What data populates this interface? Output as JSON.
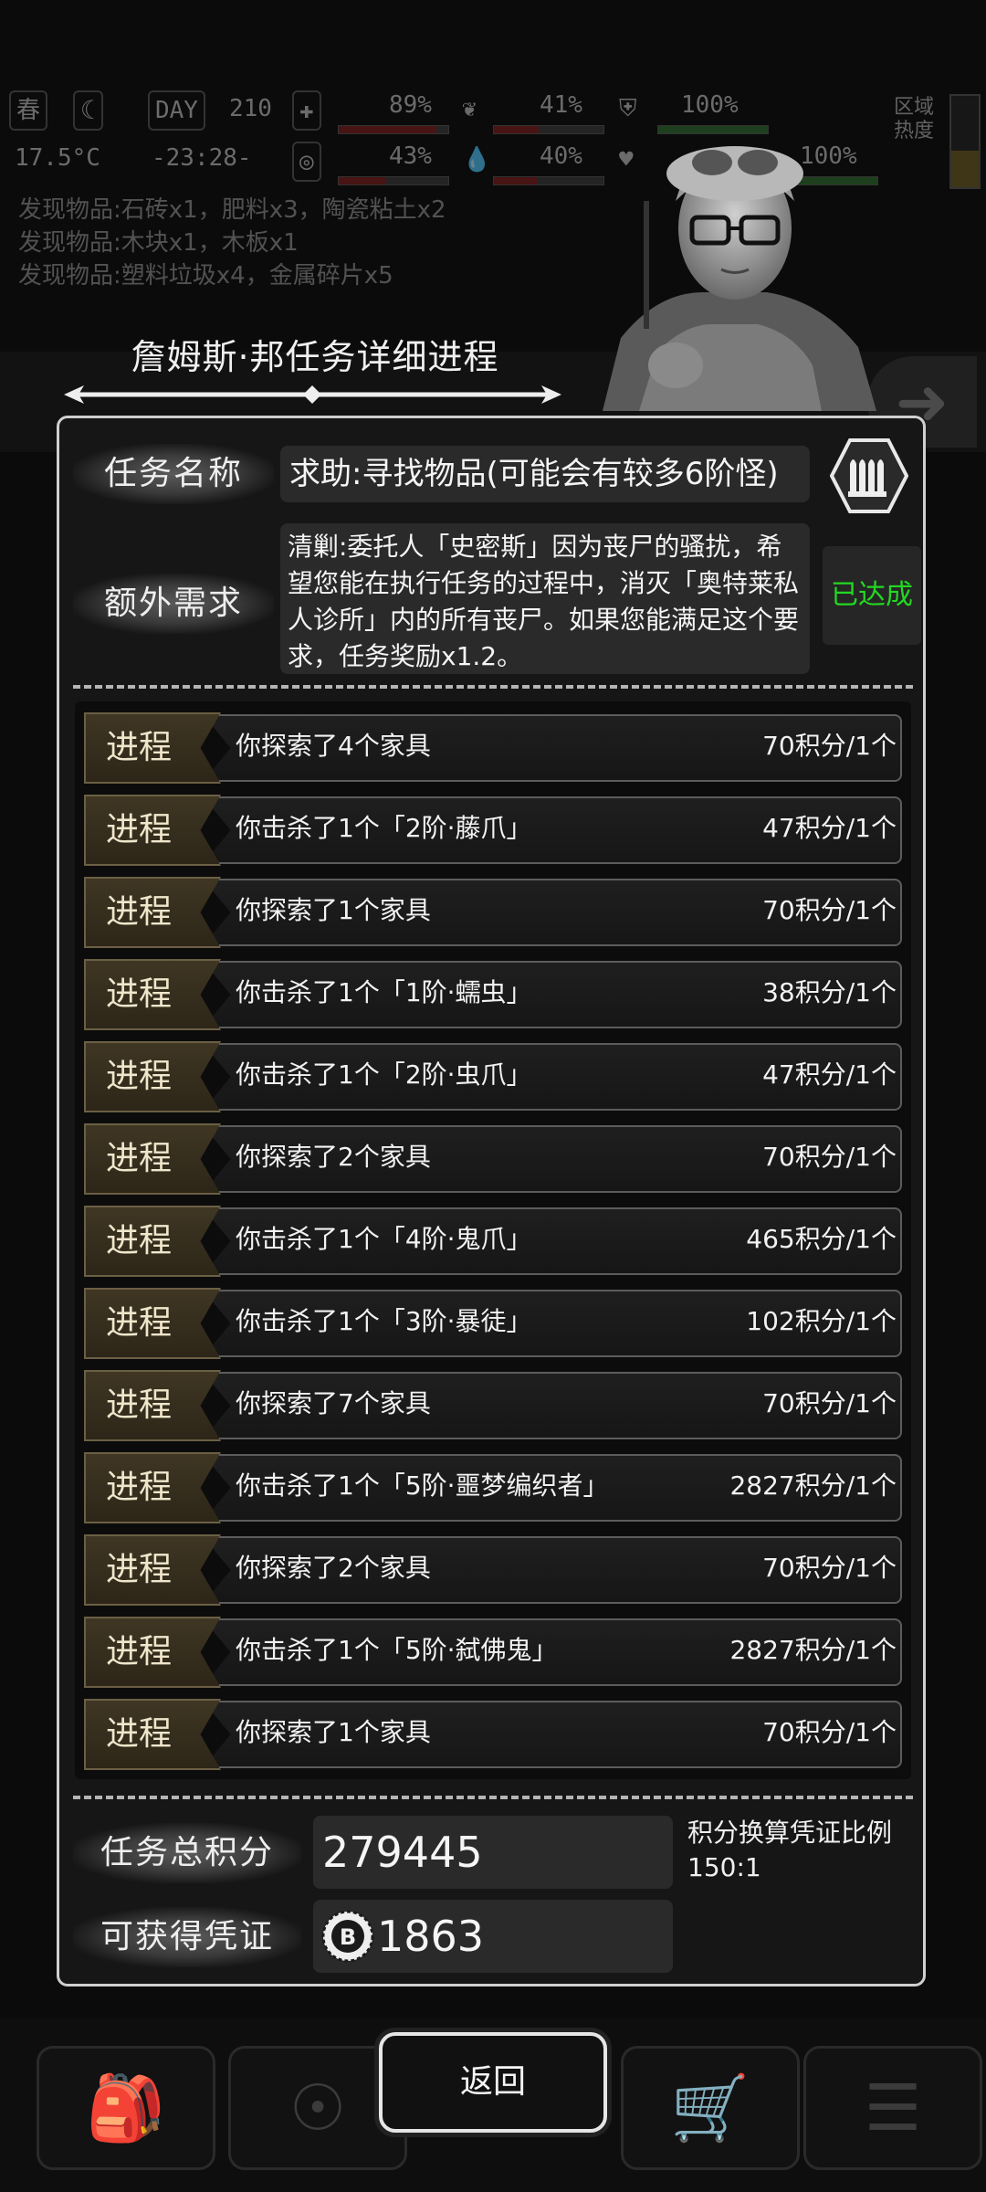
{
  "background": {
    "hud": {
      "season": "春",
      "temperature": "17.5°C",
      "day_label": "DAY",
      "day": "210",
      "time": "-23:28-",
      "health_pct": "89%",
      "sanity_pct": "43%",
      "stamina_pct": "41%",
      "water_pct": "40%",
      "armor_pct": "100%",
      "mood_pct": "100%",
      "zone_heat_label": "区域热度",
      "health_level": 0.89,
      "sanity_level": 0.43,
      "stamina_level": 0.41,
      "water_level": 0.4,
      "armor_level": 1.0,
      "mood_level": 1.0
    },
    "log_lines": [
      "发现物品:石砖x1，肥料x3，陶瓷粘土x2",
      "发现物品:木块x1，木板x1",
      "发现物品:塑料垃圾x4，金属碎片x5"
    ]
  },
  "dialog": {
    "title": "詹姆斯·邦任务详细进程",
    "mission_name_label": "任务名称",
    "mission_name": "求助:寻找物品(可能会有较多6阶怪)",
    "extra_label": "额外需求",
    "extra_text": "清剿:委托人「史密斯」因为丧尸的骚扰，希望您能在执行任务的过程中，消灭「奥特莱私人诊所」内的所有丧尸。如果您能满足这个要求，任务奖励x1.2。",
    "extra_status": "已达成",
    "progress_tag": "进程",
    "progress": [
      {
        "desc": "你探索了4个家具",
        "points": "70积分/1个"
      },
      {
        "desc": "你击杀了1个「2阶·藤爪」",
        "points": "47积分/1个"
      },
      {
        "desc": "你探索了1个家具",
        "points": "70积分/1个"
      },
      {
        "desc": "你击杀了1个「1阶·蠕虫」",
        "points": "38积分/1个"
      },
      {
        "desc": "你击杀了1个「2阶·虫爪」",
        "points": "47积分/1个"
      },
      {
        "desc": "你探索了2个家具",
        "points": "70积分/1个"
      },
      {
        "desc": "你击杀了1个「4阶·鬼爪」",
        "points": "465积分/1个"
      },
      {
        "desc": "你击杀了1个「3阶·暴徒」",
        "points": "102积分/1个"
      },
      {
        "desc": "你探索了7个家具",
        "points": "70积分/1个"
      },
      {
        "desc": "你击杀了1个「5阶·噩梦编织者」",
        "points": "2827积分/1个"
      },
      {
        "desc": "你探索了2个家具",
        "points": "70积分/1个"
      },
      {
        "desc": "你击杀了1个「5阶·弑佛鬼」",
        "points": "2827积分/1个"
      },
      {
        "desc": "你探索了1个家具",
        "points": "70积分/1个"
      }
    ],
    "total_label": "任务总积分",
    "total_value": "279445",
    "voucher_label": "可获得凭证",
    "voucher_value": "1863",
    "ratio_label": "积分换算凭证比例",
    "ratio_value": "150:1"
  },
  "return_button": "返回",
  "colors": {
    "achieved": "#23d823",
    "tag_bg": "#3f3623",
    "dialog_border": "#cfcfcf"
  },
  "icons": [
    "ammo-icon",
    "coin-icon",
    "backpack-icon",
    "brain-icon",
    "cart-icon",
    "menu-icon"
  ]
}
